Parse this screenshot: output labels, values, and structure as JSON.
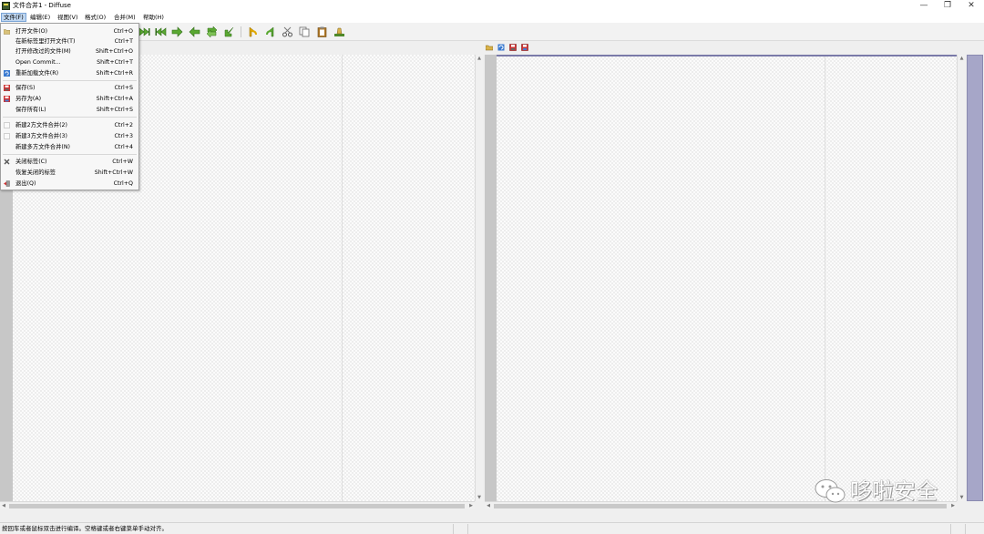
{
  "window": {
    "title": "文件合并1 - Diffuse",
    "minimize_glyph": "—",
    "restore_glyph": "❐",
    "close_glyph": "✕"
  },
  "menubar": {
    "items": [
      {
        "label": "文件(F)",
        "active": true
      },
      {
        "label": "编辑(E)"
      },
      {
        "label": "视图(V)"
      },
      {
        "label": "格式(O)"
      },
      {
        "label": "合并(M)"
      },
      {
        "label": "帮助(H)"
      }
    ]
  },
  "file_menu": {
    "items": [
      {
        "label": "打开文件(O)",
        "accel": "Ctrl+O",
        "icon": "folder-open-icon"
      },
      {
        "label": "在新标签里打开文件(T)",
        "accel": "Ctrl+T",
        "icon": ""
      },
      {
        "label": "打开修改过的文件(M)",
        "accel": "Shift+Ctrl+O",
        "icon": ""
      },
      {
        "label": "Open Commit...",
        "accel": "Shift+Ctrl+T",
        "icon": ""
      },
      {
        "label": "重新加载文件(R)",
        "accel": "Shift+Ctrl+R",
        "icon": "reload-icon"
      },
      {
        "label": "保存(S)",
        "accel": "Ctrl+S",
        "icon": "save-icon"
      },
      {
        "label": "另存为(A)",
        "accel": "Shift+Ctrl+A",
        "icon": "save-as-icon"
      },
      {
        "label": "保存所有(L)",
        "accel": "Shift+Ctrl+S",
        "icon": ""
      },
      {
        "label": "新建2方文件合并(2)",
        "accel": "Ctrl+2",
        "icon": "new-file-icon"
      },
      {
        "label": "新建3方文件合并(3)",
        "accel": "Ctrl+3",
        "icon": "new-file-icon"
      },
      {
        "label": "新建多方文件合并(N)",
        "accel": "Ctrl+4",
        "icon": ""
      },
      {
        "label": "关闭标签(C)",
        "accel": "Ctrl+W",
        "icon": "close-tab-icon"
      },
      {
        "label": "恢复关闭的标签",
        "accel": "Shift+Ctrl+W",
        "icon": ""
      },
      {
        "label": "退出(Q)",
        "accel": "Ctrl+Q",
        "icon": "quit-icon"
      }
    ]
  },
  "toolbar": {
    "icons": [
      "last-change-icon",
      "first-change-icon",
      "next-change-icon",
      "previous-change-icon",
      "merge-from-left-icon",
      "merge-from-right-icon",
      "undo-icon",
      "redo-icon",
      "cut-icon",
      "copy-icon",
      "paste-icon",
      "clear-edits-icon"
    ]
  },
  "right_pane_header": {
    "icons": [
      "open-file-icon",
      "reload-file-icon",
      "save-file-icon",
      "save-file-as-icon"
    ]
  },
  "statusbar": {
    "text": "按回车或者鼠标双击进行编译。空格键或者右键菜单手动对齐。"
  },
  "watermark": {
    "text": "哆啦安全"
  },
  "colors": {
    "menu_active": "#bfd6f0",
    "overview": "#a6a6c8",
    "toolbar_green": "#5aa832",
    "toolbar_yellow": "#e0a800"
  }
}
